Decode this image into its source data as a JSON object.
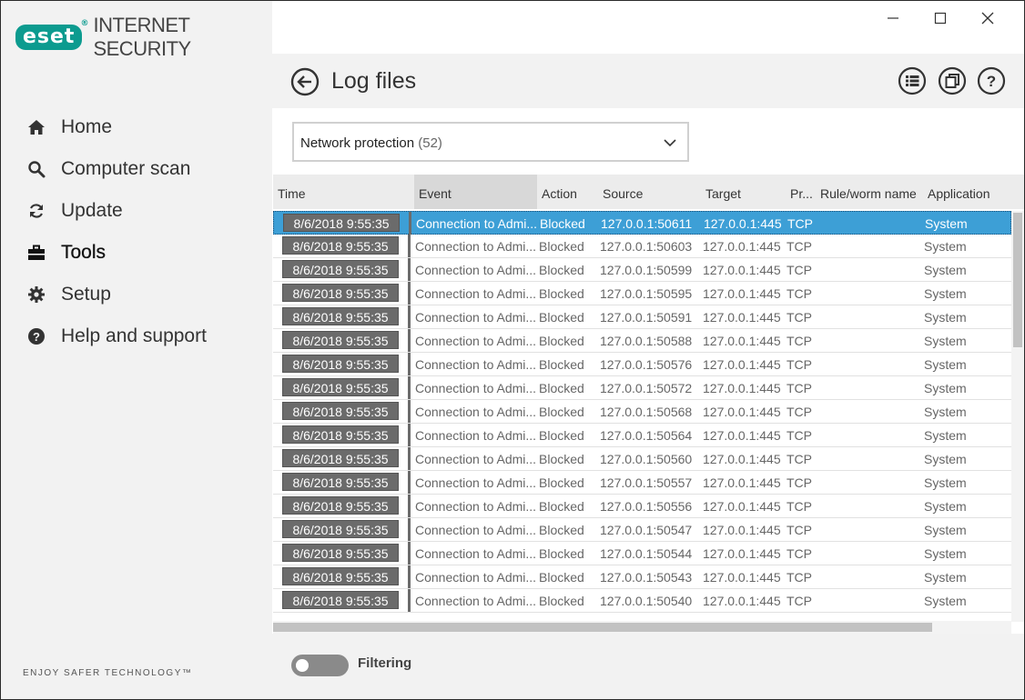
{
  "app": {
    "logo_text": "eset",
    "logo_reg": "®",
    "product": "INTERNET SECURITY",
    "tagline": "ENJOY SAFER TECHNOLOGY™"
  },
  "sidebar": {
    "items": [
      {
        "label": "Home",
        "icon": "home-icon"
      },
      {
        "label": "Computer scan",
        "icon": "search-icon"
      },
      {
        "label": "Update",
        "icon": "refresh-icon"
      },
      {
        "label": "Tools",
        "icon": "toolbox-icon",
        "active": true
      },
      {
        "label": "Setup",
        "icon": "gear-icon"
      },
      {
        "label": "Help and support",
        "icon": "help-icon"
      }
    ]
  },
  "header": {
    "title": "Log files"
  },
  "filter_select": {
    "value": "Network protection",
    "count": "(52)"
  },
  "table": {
    "columns": [
      "Time",
      "Event",
      "Action",
      "Source",
      "Target",
      "Pr...",
      "Rule/worm name",
      "Application"
    ],
    "rows": [
      {
        "time": "8/6/2018 9:55:35",
        "event": "Connection to Admi...",
        "action": "Blocked",
        "source": "127.0.0.1:50611",
        "target": "127.0.0.1:445",
        "protocol": "TCP",
        "rule": "",
        "application": "System"
      },
      {
        "time": "8/6/2018 9:55:35",
        "event": "Connection to Admi...",
        "action": "Blocked",
        "source": "127.0.0.1:50603",
        "target": "127.0.0.1:445",
        "protocol": "TCP",
        "rule": "",
        "application": "System"
      },
      {
        "time": "8/6/2018 9:55:35",
        "event": "Connection to Admi...",
        "action": "Blocked",
        "source": "127.0.0.1:50599",
        "target": "127.0.0.1:445",
        "protocol": "TCP",
        "rule": "",
        "application": "System"
      },
      {
        "time": "8/6/2018 9:55:35",
        "event": "Connection to Admi...",
        "action": "Blocked",
        "source": "127.0.0.1:50595",
        "target": "127.0.0.1:445",
        "protocol": "TCP",
        "rule": "",
        "application": "System"
      },
      {
        "time": "8/6/2018 9:55:35",
        "event": "Connection to Admi...",
        "action": "Blocked",
        "source": "127.0.0.1:50591",
        "target": "127.0.0.1:445",
        "protocol": "TCP",
        "rule": "",
        "application": "System"
      },
      {
        "time": "8/6/2018 9:55:35",
        "event": "Connection to Admi...",
        "action": "Blocked",
        "source": "127.0.0.1:50588",
        "target": "127.0.0.1:445",
        "protocol": "TCP",
        "rule": "",
        "application": "System"
      },
      {
        "time": "8/6/2018 9:55:35",
        "event": "Connection to Admi...",
        "action": "Blocked",
        "source": "127.0.0.1:50576",
        "target": "127.0.0.1:445",
        "protocol": "TCP",
        "rule": "",
        "application": "System"
      },
      {
        "time": "8/6/2018 9:55:35",
        "event": "Connection to Admi...",
        "action": "Blocked",
        "source": "127.0.0.1:50572",
        "target": "127.0.0.1:445",
        "protocol": "TCP",
        "rule": "",
        "application": "System"
      },
      {
        "time": "8/6/2018 9:55:35",
        "event": "Connection to Admi...",
        "action": "Blocked",
        "source": "127.0.0.1:50568",
        "target": "127.0.0.1:445",
        "protocol": "TCP",
        "rule": "",
        "application": "System"
      },
      {
        "time": "8/6/2018 9:55:35",
        "event": "Connection to Admi...",
        "action": "Blocked",
        "source": "127.0.0.1:50564",
        "target": "127.0.0.1:445",
        "protocol": "TCP",
        "rule": "",
        "application": "System"
      },
      {
        "time": "8/6/2018 9:55:35",
        "event": "Connection to Admi...",
        "action": "Blocked",
        "source": "127.0.0.1:50560",
        "target": "127.0.0.1:445",
        "protocol": "TCP",
        "rule": "",
        "application": "System"
      },
      {
        "time": "8/6/2018 9:55:35",
        "event": "Connection to Admi...",
        "action": "Blocked",
        "source": "127.0.0.1:50557",
        "target": "127.0.0.1:445",
        "protocol": "TCP",
        "rule": "",
        "application": "System"
      },
      {
        "time": "8/6/2018 9:55:35",
        "event": "Connection to Admi...",
        "action": "Blocked",
        "source": "127.0.0.1:50556",
        "target": "127.0.0.1:445",
        "protocol": "TCP",
        "rule": "",
        "application": "System"
      },
      {
        "time": "8/6/2018 9:55:35",
        "event": "Connection to Admi...",
        "action": "Blocked",
        "source": "127.0.0.1:50547",
        "target": "127.0.0.1:445",
        "protocol": "TCP",
        "rule": "",
        "application": "System"
      },
      {
        "time": "8/6/2018 9:55:35",
        "event": "Connection to Admi...",
        "action": "Blocked",
        "source": "127.0.0.1:50544",
        "target": "127.0.0.1:445",
        "protocol": "TCP",
        "rule": "",
        "application": "System"
      },
      {
        "time": "8/6/2018 9:55:35",
        "event": "Connection to Admi...",
        "action": "Blocked",
        "source": "127.0.0.1:50543",
        "target": "127.0.0.1:445",
        "protocol": "TCP",
        "rule": "",
        "application": "System"
      },
      {
        "time": "8/6/2018 9:55:35",
        "event": "Connection to Admi...",
        "action": "Blocked",
        "source": "127.0.0.1:50540",
        "target": "127.0.0.1:445",
        "protocol": "TCP",
        "rule": "",
        "application": "System"
      }
    ],
    "selected_index": 0
  },
  "footer": {
    "filter_label": "Filtering",
    "filter_on": false
  },
  "colors": {
    "brand": "#0c9b8f",
    "selection": "#3d9fd6",
    "sidebar_bg": "#f2f2f2"
  }
}
